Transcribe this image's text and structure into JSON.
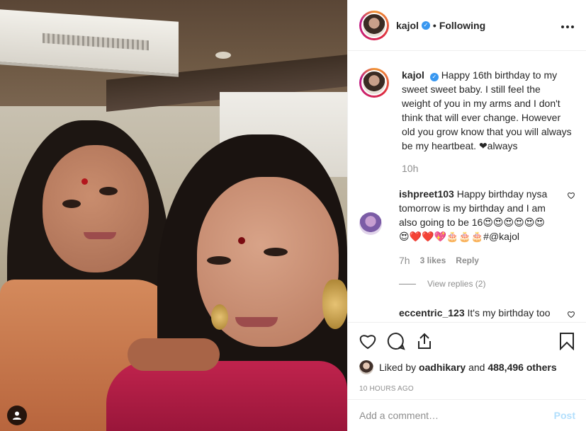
{
  "post": {
    "header": {
      "username": "kajol",
      "dot": "•",
      "follow_state": "Following",
      "more_icon": "more-horizontal-icon"
    },
    "caption": {
      "username": "kajol",
      "text": "Happy 16th birthday to my sweet sweet baby. I still feel the weight of you in my arms and I don't think that will ever change. However old you grow know that you will always be my heartbeat. ❤always",
      "time": "10h"
    },
    "comments": [
      {
        "username": "ishpreet103",
        "text": "Happy birthday nysa tomorrow is my birthday and I am also going to be 16😍😍😍😍😍😍😍❤️❤️💖🎂🎂🎂#@kajol",
        "time": "7h",
        "likes": "3 likes",
        "reply": "Reply",
        "view_replies": "View replies (2)"
      },
      {
        "username": "eccentric_123",
        "text": "It's my birthday too"
      }
    ],
    "likes": {
      "prefix": "Liked by",
      "user": "oadhikary",
      "and": "and",
      "count": "488,496 others"
    },
    "timestamp": "10 HOURS AGO",
    "add_comment": {
      "placeholder": "Add a comment…",
      "post_label": "Post"
    },
    "colors": {
      "verified": "#3897f0",
      "muted": "#8e8e8e",
      "post_disabled": "#b2dffc"
    }
  }
}
